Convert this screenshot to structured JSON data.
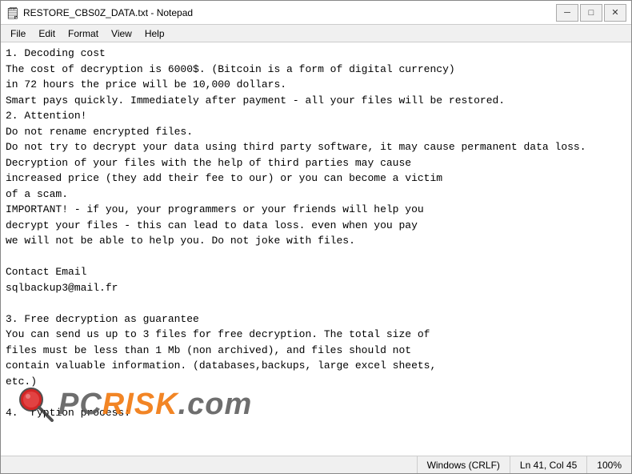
{
  "window": {
    "title": "RESTORE_CBS0Z_DATA.txt - Notepad",
    "icon": "📄"
  },
  "controls": {
    "minimize": "─",
    "maximize": "□",
    "close": "✕"
  },
  "menu": {
    "items": [
      "File",
      "Edit",
      "Format",
      "View",
      "Help"
    ]
  },
  "content": "1. Decoding cost\nThe cost of decryption is 6000$. (Bitcoin is a form of digital currency)\nin 72 hours the price will be 10,000 dollars.\nSmart pays quickly. Immediately after payment - all your files will be restored.\n2. Attention!\nDo not rename encrypted files.\nDo not try to decrypt your data using third party software, it may cause permanent data loss.\nDecryption of your files with the help of third parties may cause\nincreased price (they add their fee to our) or you can become a victim\nof a scam.\nIMPORTANT! - if you, your programmers or your friends will help you\ndecrypt your files - this can lead to data loss. even when you pay\nwe will not be able to help you. Do not joke with files.\n\nContact Email\nsqlbackup3@mail.fr\n\n3. Free decryption as guarantee\nYou can send us up to 3 files for free decryption. The total size of\nfiles must be less than 1 Mb (non archived), and files should not\ncontain valuable information. (databases,backups, large excel sheets,\netc.)\n\n4.  ryption process:",
  "status": {
    "encoding": "Windows (CRLF)",
    "position": "Ln 41, Col 45",
    "zoom": "100%"
  },
  "watermark": {
    "text_pc": "PC",
    "text_separator": "·",
    "text_risk": "RISK",
    "text_com": ".com"
  }
}
